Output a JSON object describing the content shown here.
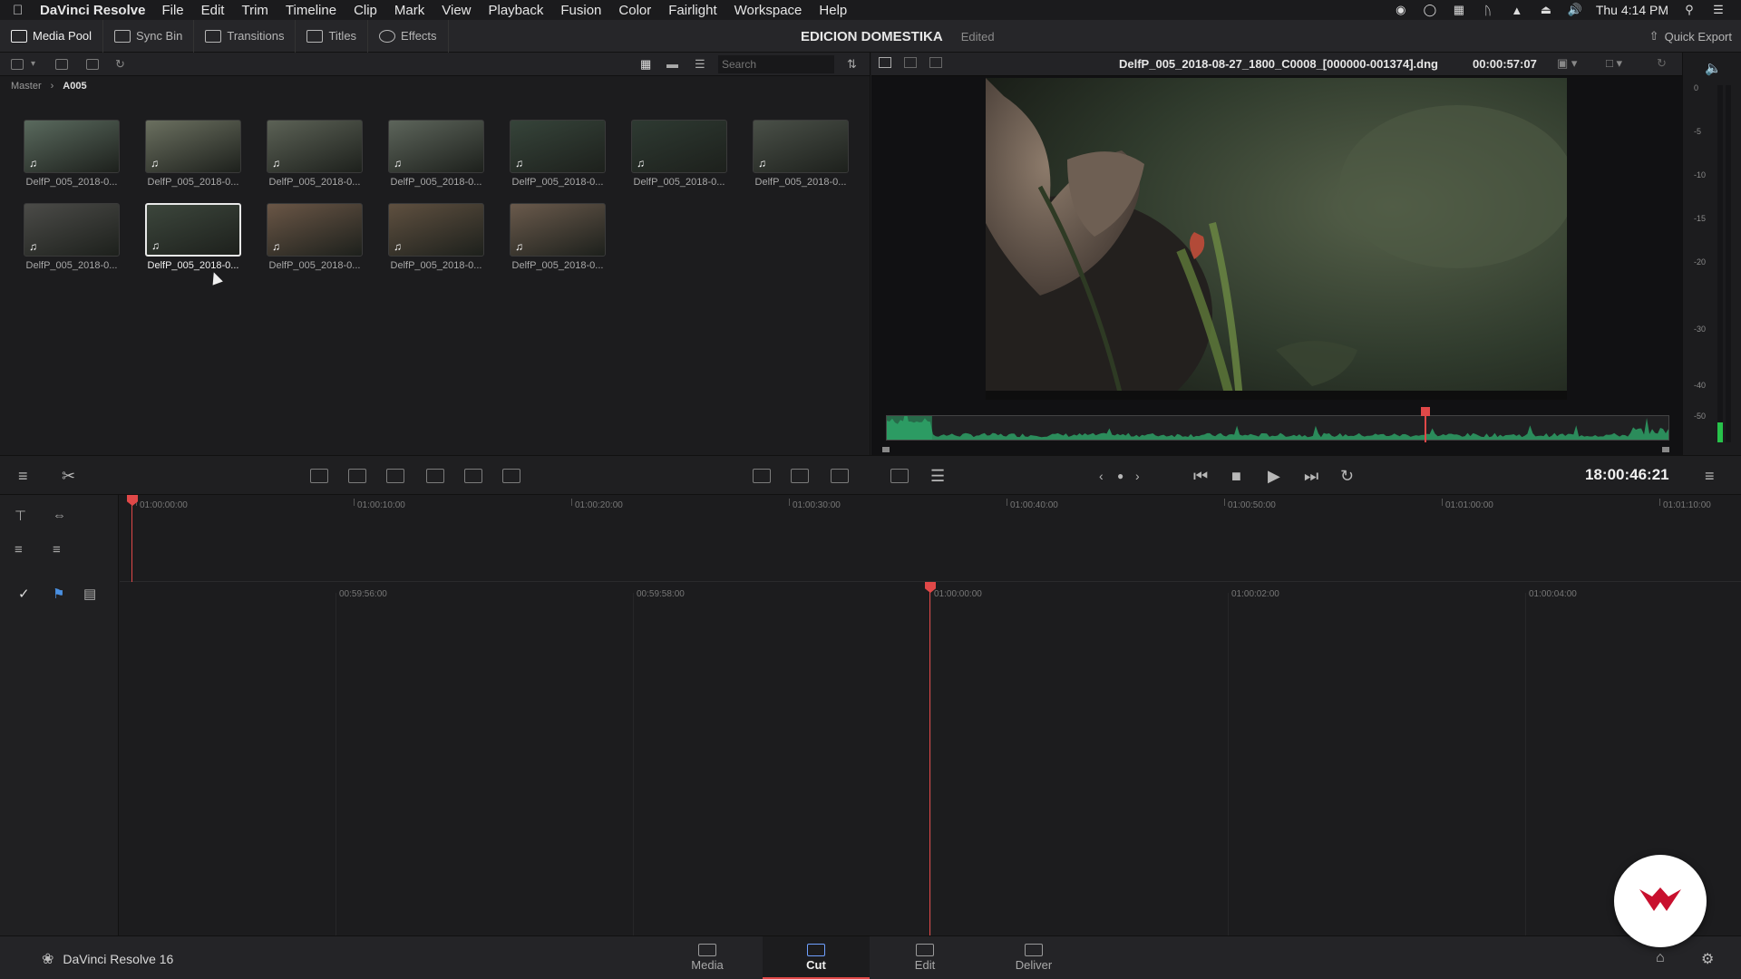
{
  "menubar": {
    "app_name": "DaVinci Resolve",
    "items": [
      "File",
      "Edit",
      "Trim",
      "Timeline",
      "Clip",
      "Mark",
      "View",
      "Playback",
      "Fusion",
      "Color",
      "Fairlight",
      "Workspace",
      "Help"
    ],
    "clock": "Thu 4:14 PM"
  },
  "toolbar": {
    "media_pool": "Media Pool",
    "sync_bin": "Sync Bin",
    "transitions": "Transitions",
    "titles": "Titles",
    "effects": "Effects",
    "project_name": "EDICION DOMESTIKA",
    "project_status": "Edited",
    "quick_export": "Quick Export"
  },
  "pool": {
    "search_placeholder": "Search",
    "breadcrumb_root": "Master",
    "breadcrumb_current": "A005",
    "clips": [
      {
        "label": "DelfP_005_2018-0...",
        "selected": false
      },
      {
        "label": "DelfP_005_2018-0...",
        "selected": false
      },
      {
        "label": "DelfP_005_2018-0...",
        "selected": false
      },
      {
        "label": "DelfP_005_2018-0...",
        "selected": false
      },
      {
        "label": "DelfP_005_2018-0...",
        "selected": false
      },
      {
        "label": "DelfP_005_2018-0...",
        "selected": false
      },
      {
        "label": "DelfP_005_2018-0...",
        "selected": false
      },
      {
        "label": "DelfP_005_2018-0...",
        "selected": false
      },
      {
        "label": "DelfP_005_2018-0...",
        "selected": true
      },
      {
        "label": "DelfP_005_2018-0...",
        "selected": false
      },
      {
        "label": "DelfP_005_2018-0...",
        "selected": false
      },
      {
        "label": "DelfP_005_2018-0...",
        "selected": false
      }
    ]
  },
  "viewer": {
    "filename": "DelfP_005_2018-08-27_1800_C0008_[000000-001374].dng",
    "duration": "00:00:57:07",
    "timecode": "18:00:46:21",
    "meter_labels": [
      "0",
      "-5",
      "-10",
      "-15",
      "-20",
      "-30",
      "-40",
      "-50"
    ]
  },
  "timeline": {
    "upper_ruler": [
      "01:00:00:00",
      "01:00:10:00",
      "01:00:20:00",
      "01:00:30:00",
      "01:00:40:00",
      "01:00:50:00",
      "01:01:00:00",
      "01:01:10:00"
    ],
    "lower_ruler": [
      "00:59:56:00",
      "00:59:58:00",
      "01:00:00:00",
      "01:00:02:00",
      "01:00:04:00"
    ]
  },
  "pages": {
    "brand": "DaVinci Resolve 16",
    "tabs": [
      {
        "label": "Media",
        "active": false
      },
      {
        "label": "Cut",
        "active": true
      },
      {
        "label": "Edit",
        "active": false
      },
      {
        "label": "Deliver",
        "active": false
      }
    ]
  },
  "colors": {
    "accent_red": "#e04848",
    "waveform_green": "#2ea86a",
    "meter_green": "#27c24a",
    "badge_red": "#c8102e"
  }
}
